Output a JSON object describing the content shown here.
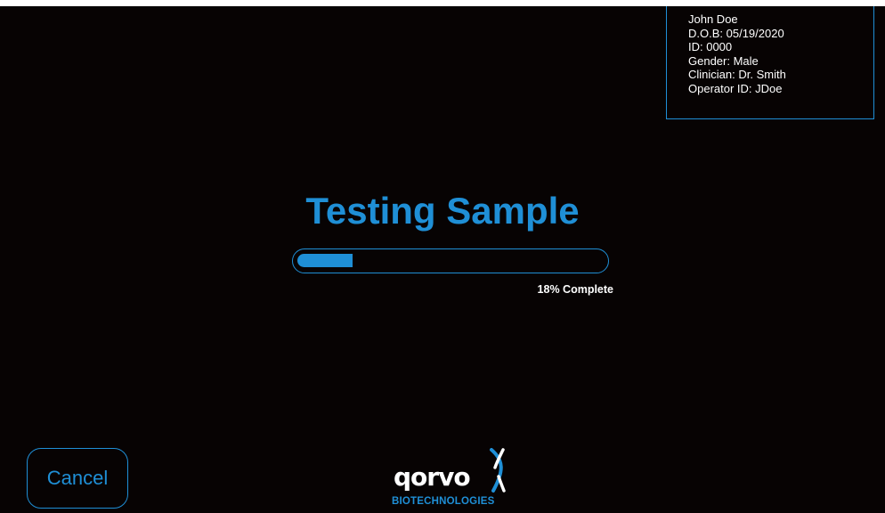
{
  "patient": {
    "name": "John Doe",
    "dob": "D.O.B: 05/19/2020",
    "id": "ID: 0000",
    "gender": "Gender: Male",
    "clinician": "Clinician: Dr. Smith",
    "operator": "Operator ID: JDoe"
  },
  "main": {
    "title": "Testing Sample",
    "progress_percent": 18,
    "progress_label": "18% Complete"
  },
  "actions": {
    "cancel_label": "Cancel"
  },
  "logo": {
    "wordmark": "qorvo",
    "tagline": "BIOTECHNOLOGIES"
  },
  "colors": {
    "background": "#070303",
    "accent": "#1f8fd6",
    "text": "#ffffff"
  },
  "icons": {
    "logo_mark": "dna-helix-icon"
  }
}
